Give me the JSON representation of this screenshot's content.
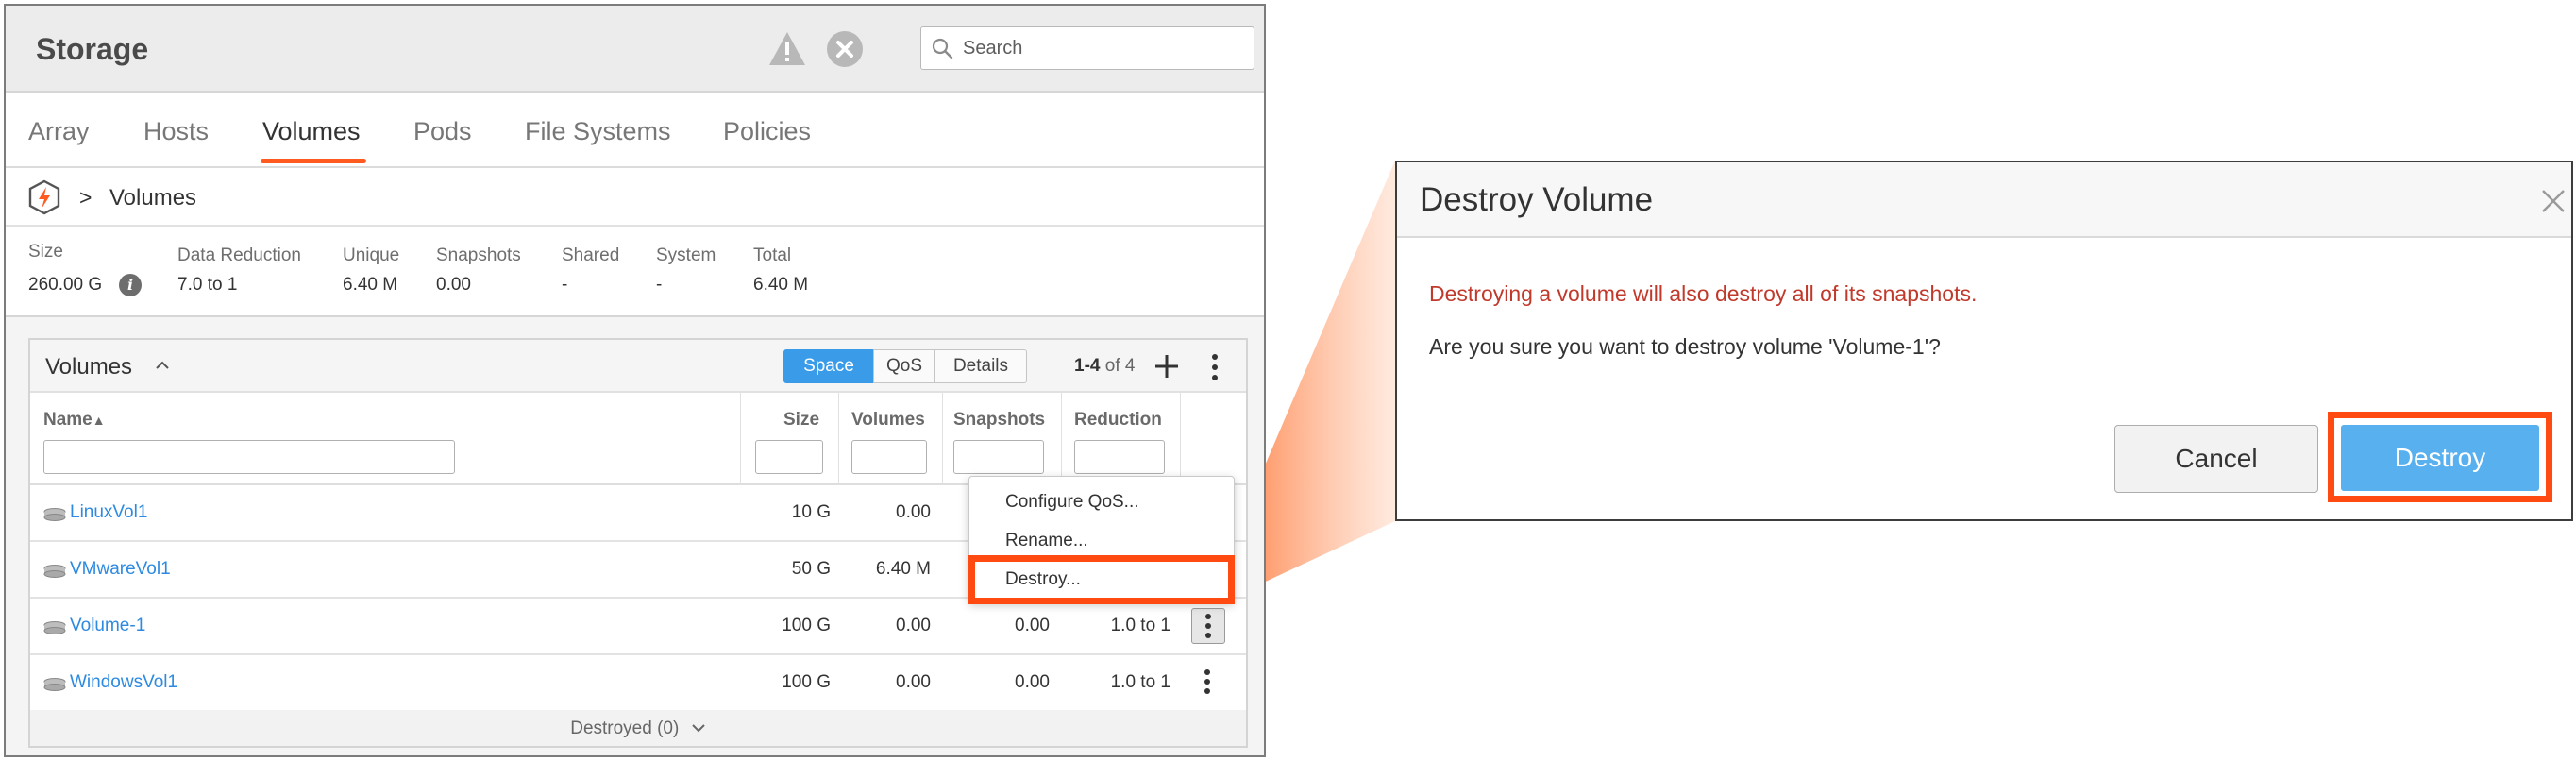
{
  "app": {
    "title": "Storage"
  },
  "search": {
    "placeholder": "Search"
  },
  "tabs": [
    {
      "label": "Array"
    },
    {
      "label": "Hosts"
    },
    {
      "label": "Volumes",
      "active": true
    },
    {
      "label": "Pods"
    },
    {
      "label": "File Systems"
    },
    {
      "label": "Policies"
    }
  ],
  "breadcrumb": {
    "separator": ">",
    "current": "Volumes"
  },
  "stats": [
    {
      "label": "Size",
      "value": "260.00 G"
    },
    {
      "label": "Data Reduction",
      "value": "7.0 to 1"
    },
    {
      "label": "Unique",
      "value": "6.40 M"
    },
    {
      "label": "Snapshots",
      "value": "0.00"
    },
    {
      "label": "Shared",
      "value": "-"
    },
    {
      "label": "System",
      "value": "-"
    },
    {
      "label": "Total",
      "value": "6.40 M"
    }
  ],
  "volumes_card": {
    "title": "Volumes",
    "views": [
      "Space",
      "QoS",
      "Details"
    ],
    "active_view": "Space",
    "count_range": "1-4",
    "count_of": "of 4",
    "columns": [
      "Name",
      "Size",
      "Volumes",
      "Snapshots",
      "Reduction"
    ],
    "sort_indicator": "▲",
    "rows": [
      {
        "name": "LinuxVol1",
        "size": "10 G",
        "volumes": "0.00",
        "snapshots": "",
        "reduction": ""
      },
      {
        "name": "VMwareVol1",
        "size": "50 G",
        "volumes": "6.40 M",
        "snapshots": "",
        "reduction": ""
      },
      {
        "name": "Volume-1",
        "size": "100 G",
        "volumes": "0.00",
        "snapshots": "0.00",
        "reduction": "1.0 to 1"
      },
      {
        "name": "WindowsVol1",
        "size": "100 G",
        "volumes": "0.00",
        "snapshots": "0.00",
        "reduction": "1.0 to 1"
      }
    ],
    "destroyed_label": "Destroyed (0)"
  },
  "context_menu": {
    "items": [
      "Configure QoS...",
      "Rename...",
      "Destroy..."
    ]
  },
  "dialog": {
    "title": "Destroy Volume",
    "warning": "Destroying a volume will also destroy all of its snapshots.",
    "question": "Are you sure you want to destroy volume 'Volume-1'?",
    "cancel_label": "Cancel",
    "confirm_label": "Destroy"
  },
  "colors": {
    "accent": "#ff5a1f",
    "highlight": "#ff4a12",
    "primary_button": "#58b0ef",
    "active_segment": "#3a9ce8",
    "link": "#2d8ae0",
    "warning_text": "#c0392b"
  }
}
